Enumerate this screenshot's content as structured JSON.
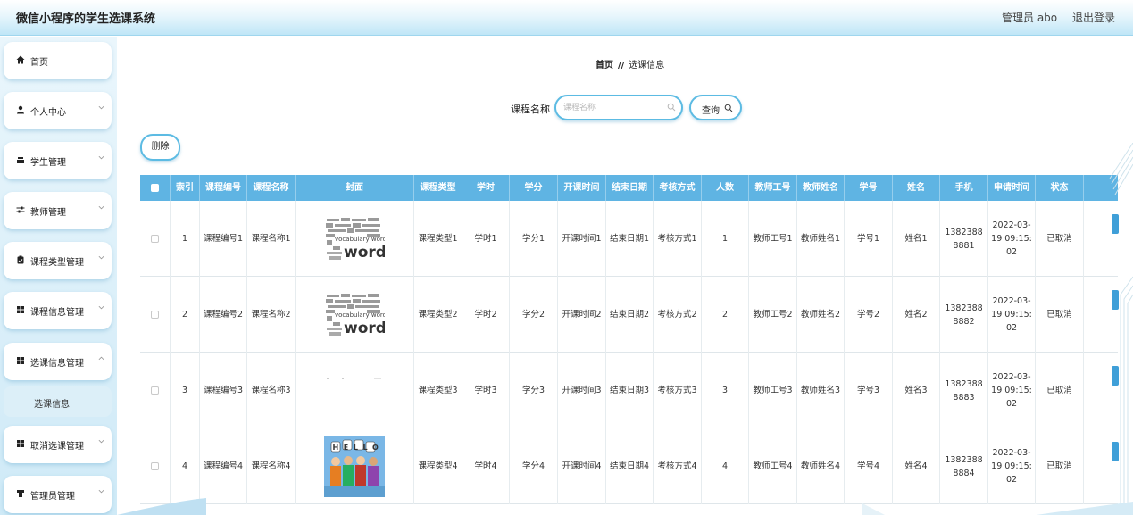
{
  "header": {
    "title": "微信小程序的学生选课系统",
    "user": "管理员 abo",
    "logout": "退出登录"
  },
  "sidebar": {
    "items": [
      {
        "label": "首页",
        "icon": "home-icon"
      },
      {
        "label": "个人中心",
        "icon": "user-icon"
      },
      {
        "label": "学生管理",
        "icon": "student-icon"
      },
      {
        "label": "教师管理",
        "icon": "sliders-icon"
      },
      {
        "label": "课程类型管理",
        "icon": "clipboard-icon"
      },
      {
        "label": "课程信息管理",
        "icon": "grid-icon"
      },
      {
        "label": "选课信息管理",
        "icon": "grid-icon"
      },
      {
        "label": "取消选课管理",
        "icon": "grid-icon"
      },
      {
        "label": "管理员管理",
        "icon": "admin-icon"
      }
    ],
    "sub_item": "选课信息"
  },
  "breadcrumb": {
    "home": "首页",
    "separator": "//",
    "current": "选课信息"
  },
  "search": {
    "label": "课程名称",
    "placeholder": "课程名称",
    "button": "查询"
  },
  "toolbar": {
    "delete": "删除"
  },
  "table": {
    "headers": [
      "索引",
      "课程编号",
      "课程名称",
      "封面",
      "课程类型",
      "学时",
      "学分",
      "开课时间",
      "结束日期",
      "考核方式",
      "人数",
      "教师工号",
      "教师姓名",
      "学号",
      "姓名",
      "手机",
      "申请时间",
      "状态"
    ],
    "rows": [
      {
        "index": "1",
        "course_no": "课程编号1",
        "course_name": "课程名称1",
        "cover": "vocabulary words",
        "course_type": "课程类型1",
        "hours": "学时1",
        "credit": "学分1",
        "start_time": "开课时间1",
        "end_date": "结束日期1",
        "exam": "考核方式1",
        "count": "1",
        "teacher_no": "教师工号1",
        "teacher_name": "教师姓名1",
        "student_no": "学号1",
        "name": "姓名1",
        "phone": "13823888881",
        "apply_time": "2022-03-19 09:15:02",
        "status": "已取消"
      },
      {
        "index": "2",
        "course_no": "课程编号2",
        "course_name": "课程名称2",
        "cover": "vocabulary words",
        "course_type": "课程类型2",
        "hours": "学时2",
        "credit": "学分2",
        "start_time": "开课时间2",
        "end_date": "结束日期2",
        "exam": "考核方式2",
        "count": "2",
        "teacher_no": "教师工号2",
        "teacher_name": "教师姓名2",
        "student_no": "学号2",
        "name": "姓名2",
        "phone": "13823888882",
        "apply_time": "2022-03-19 09:15:02",
        "status": "已取消"
      },
      {
        "index": "3",
        "course_no": "课程编号3",
        "course_name": "课程名称3",
        "cover": "",
        "course_type": "课程类型3",
        "hours": "学时3",
        "credit": "学分3",
        "start_time": "开课时间3",
        "end_date": "结束日期3",
        "exam": "考核方式3",
        "count": "3",
        "teacher_no": "教师工号3",
        "teacher_name": "教师姓名3",
        "student_no": "学号3",
        "name": "姓名3",
        "phone": "13823888883",
        "apply_time": "2022-03-19 09:15:02",
        "status": "已取消"
      },
      {
        "index": "4",
        "course_no": "课程编号4",
        "course_name": "课程名称4",
        "cover": "HELLO",
        "course_type": "课程类型4",
        "hours": "学时4",
        "credit": "学分4",
        "start_time": "开课时间4",
        "end_date": "结束日期4",
        "exam": "考核方式4",
        "count": "4",
        "teacher_no": "教师工号4",
        "teacher_name": "教师姓名4",
        "student_no": "学号4",
        "name": "姓名4",
        "phone": "13823888884",
        "apply_time": "2022-03-19 09:15:02",
        "status": "已取消"
      }
    ]
  },
  "colors": {
    "accent": "#5cbbe3",
    "table_header": "#5fb4e3",
    "sidebar_bg": "#d6eef9",
    "header_bg": "#bfe6f7"
  }
}
